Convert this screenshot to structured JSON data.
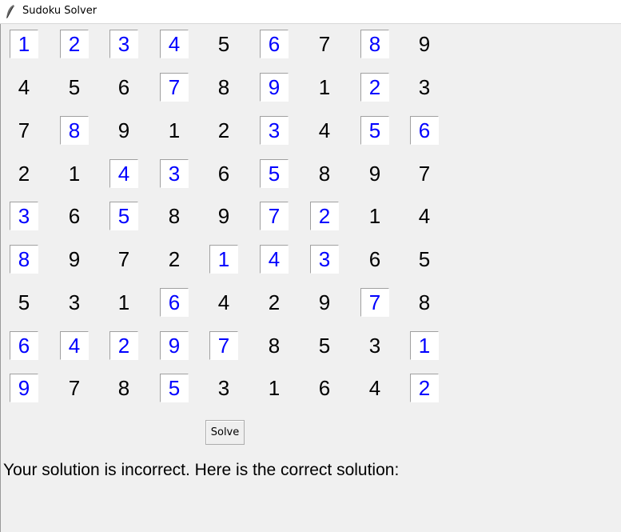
{
  "window": {
    "title": "Sudoku Solver",
    "icon": "feather-icon"
  },
  "board": {
    "rows": [
      [
        {
          "v": "1",
          "editable": true
        },
        {
          "v": "2",
          "editable": true
        },
        {
          "v": "3",
          "editable": true
        },
        {
          "v": "4",
          "editable": true
        },
        {
          "v": "5",
          "editable": false
        },
        {
          "v": "6",
          "editable": true
        },
        {
          "v": "7",
          "editable": false
        },
        {
          "v": "8",
          "editable": true
        },
        {
          "v": "9",
          "editable": false
        }
      ],
      [
        {
          "v": "4",
          "editable": false
        },
        {
          "v": "5",
          "editable": false
        },
        {
          "v": "6",
          "editable": false
        },
        {
          "v": "7",
          "editable": true
        },
        {
          "v": "8",
          "editable": false
        },
        {
          "v": "9",
          "editable": true
        },
        {
          "v": "1",
          "editable": false
        },
        {
          "v": "2",
          "editable": true
        },
        {
          "v": "3",
          "editable": false
        }
      ],
      [
        {
          "v": "7",
          "editable": false
        },
        {
          "v": "8",
          "editable": true
        },
        {
          "v": "9",
          "editable": false
        },
        {
          "v": "1",
          "editable": false
        },
        {
          "v": "2",
          "editable": false
        },
        {
          "v": "3",
          "editable": true
        },
        {
          "v": "4",
          "editable": false
        },
        {
          "v": "5",
          "editable": true
        },
        {
          "v": "6",
          "editable": true
        }
      ],
      [
        {
          "v": "2",
          "editable": false
        },
        {
          "v": "1",
          "editable": false
        },
        {
          "v": "4",
          "editable": true
        },
        {
          "v": "3",
          "editable": true
        },
        {
          "v": "6",
          "editable": false
        },
        {
          "v": "5",
          "editable": true
        },
        {
          "v": "8",
          "editable": false
        },
        {
          "v": "9",
          "editable": false
        },
        {
          "v": "7",
          "editable": false
        }
      ],
      [
        {
          "v": "3",
          "editable": true
        },
        {
          "v": "6",
          "editable": false
        },
        {
          "v": "5",
          "editable": true
        },
        {
          "v": "8",
          "editable": false
        },
        {
          "v": "9",
          "editable": false
        },
        {
          "v": "7",
          "editable": true
        },
        {
          "v": "2",
          "editable": true
        },
        {
          "v": "1",
          "editable": false
        },
        {
          "v": "4",
          "editable": false
        }
      ],
      [
        {
          "v": "8",
          "editable": true
        },
        {
          "v": "9",
          "editable": false
        },
        {
          "v": "7",
          "editable": false
        },
        {
          "v": "2",
          "editable": false
        },
        {
          "v": "1",
          "editable": true
        },
        {
          "v": "4",
          "editable": true
        },
        {
          "v": "3",
          "editable": true
        },
        {
          "v": "6",
          "editable": false
        },
        {
          "v": "5",
          "editable": false
        }
      ],
      [
        {
          "v": "5",
          "editable": false
        },
        {
          "v": "3",
          "editable": false
        },
        {
          "v": "1",
          "editable": false
        },
        {
          "v": "6",
          "editable": true
        },
        {
          "v": "4",
          "editable": false
        },
        {
          "v": "2",
          "editable": false
        },
        {
          "v": "9",
          "editable": false
        },
        {
          "v": "7",
          "editable": true
        },
        {
          "v": "8",
          "editable": false
        }
      ],
      [
        {
          "v": "6",
          "editable": true
        },
        {
          "v": "4",
          "editable": true
        },
        {
          "v": "2",
          "editable": true
        },
        {
          "v": "9",
          "editable": true
        },
        {
          "v": "7",
          "editable": true
        },
        {
          "v": "8",
          "editable": false
        },
        {
          "v": "5",
          "editable": false
        },
        {
          "v": "3",
          "editable": false
        },
        {
          "v": "1",
          "editable": true
        }
      ],
      [
        {
          "v": "9",
          "editable": true
        },
        {
          "v": "7",
          "editable": false
        },
        {
          "v": "8",
          "editable": false
        },
        {
          "v": "5",
          "editable": true
        },
        {
          "v": "3",
          "editable": false
        },
        {
          "v": "1",
          "editable": false
        },
        {
          "v": "6",
          "editable": false
        },
        {
          "v": "4",
          "editable": false
        },
        {
          "v": "2",
          "editable": true
        }
      ]
    ],
    "colors": {
      "given": "#000000",
      "entry": "#0000ff"
    }
  },
  "controls": {
    "solve_label": "Solve"
  },
  "status": {
    "message": "Your solution is incorrect. Here is the correct solution:"
  }
}
